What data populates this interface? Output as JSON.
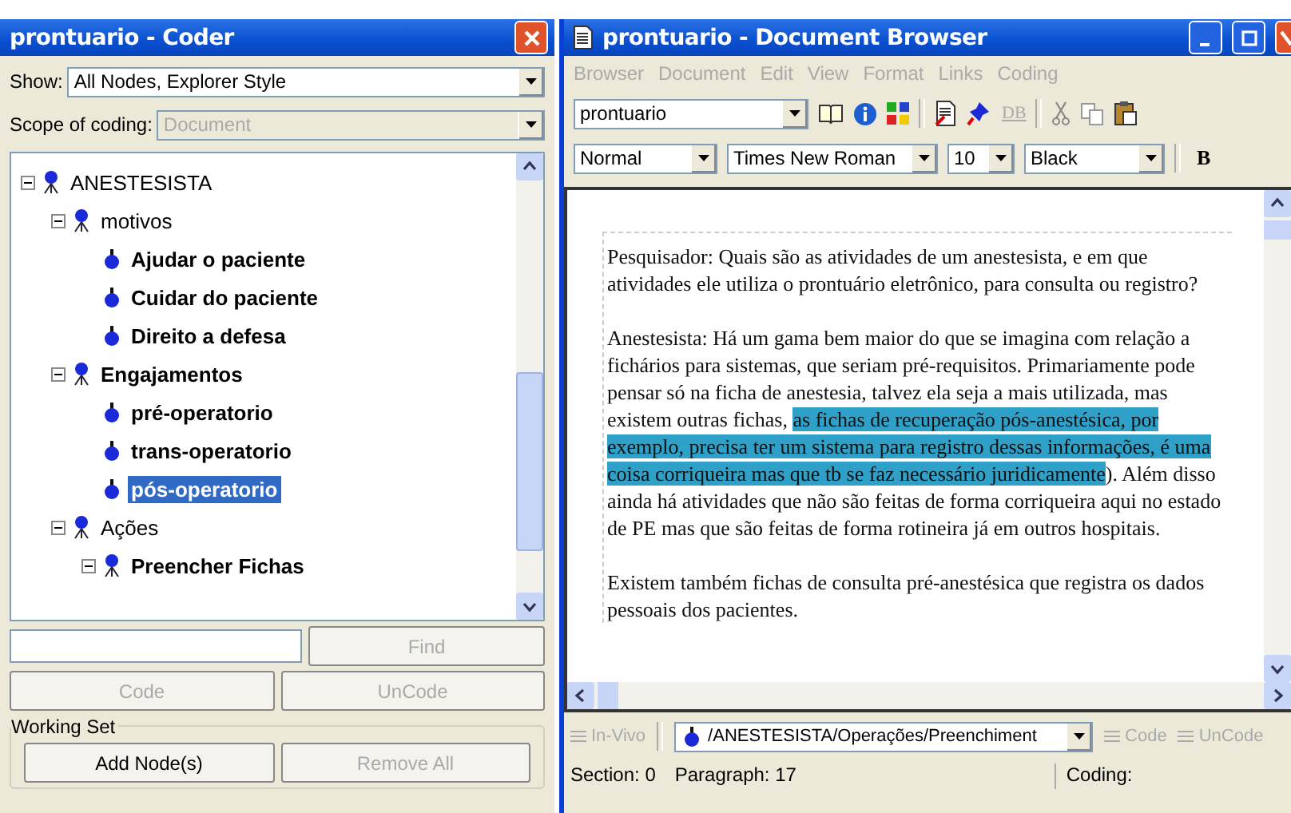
{
  "coder": {
    "title": "prontuario - Coder",
    "show": {
      "label": "Show:",
      "value": "All Nodes, Explorer Style"
    },
    "scope": {
      "label": "Scope of coding:",
      "value": "Document",
      "disabled": true
    },
    "tree": [
      {
        "label": "ANESTESISTA",
        "bold": false,
        "expanded": true,
        "selected": false,
        "children": [
          {
            "label": "motivos",
            "bold": false,
            "expanded": true,
            "selected": false,
            "children": [
              {
                "label": "Ajudar o paciente",
                "bold": true,
                "expanded": false,
                "selected": false
              },
              {
                "label": "Cuidar do paciente",
                "bold": true,
                "expanded": false,
                "selected": false
              },
              {
                "label": "Direito a defesa",
                "bold": true,
                "expanded": false,
                "selected": false
              }
            ]
          },
          {
            "label": "Engajamentos",
            "bold": true,
            "expanded": true,
            "selected": false,
            "children": [
              {
                "label": "pré-operatorio",
                "bold": true,
                "expanded": false,
                "selected": false
              },
              {
                "label": "trans-operatorio",
                "bold": true,
                "expanded": false,
                "selected": false
              },
              {
                "label": "pós-operatorio",
                "bold": true,
                "expanded": false,
                "selected": true
              }
            ]
          },
          {
            "label": "Ações",
            "bold": false,
            "expanded": true,
            "selected": false,
            "children": [
              {
                "label": "Preencher Fichas",
                "bold": true,
                "expanded": true,
                "selected": false
              }
            ]
          }
        ]
      }
    ],
    "buttons": [
      {
        "label": "Find",
        "disabled": true
      },
      {
        "label": "Code",
        "disabled": true
      },
      {
        "label": "UnCode",
        "disabled": true
      }
    ],
    "working_set": {
      "title": "Working Set",
      "buttons": [
        {
          "label": "Add Node(s)",
          "disabled": false
        },
        {
          "label": "Remove All",
          "disabled": true
        }
      ]
    }
  },
  "browser": {
    "title": "prontuario - Document Browser",
    "menu": [
      {
        "label": "Browser",
        "disabled": true
      },
      {
        "label": "Document",
        "disabled": true
      },
      {
        "label": "Edit",
        "disabled": true
      },
      {
        "label": "View",
        "disabled": true
      },
      {
        "label": "Format",
        "disabled": true
      },
      {
        "label": "Links",
        "disabled": true
      },
      {
        "label": "Coding",
        "disabled": true
      }
    ],
    "document_select": "prontuario",
    "db_button": "DB",
    "style": "Normal",
    "font": "Times New Roman",
    "size": "10",
    "text_color": "Black",
    "bold_button": "B",
    "paragraphs": [
      [
        {
          "text": "Pesquisador: Quais são as atividades de um anestesista, e em que atividades ele utiliza o prontuário eletrônico, para consulta ou registro?",
          "highlighted": false
        }
      ],
      [
        {
          "text": "Anestesista: Há um gama bem maior do que se imagina com relação a fichários para sistemas, que seriam pré-requisitos. Primariamente pode pensar só na ficha de anestesia, talvez ela seja a mais utilizada, mas existem outras fichas, ",
          "highlighted": false
        },
        {
          "text": "as fichas de recuperação pós-anestésica, por exemplo, precisa ter um sistema para registro dessas informações, é uma coisa corriqueira mas que tb se faz necessário juridicamente",
          "highlighted": true
        },
        {
          "text": "). Além disso ainda há atividades que não são feitas de forma corriqueira aqui no estado de PE mas que são feitas de forma rotineira já em outros hospitais.",
          "highlighted": false
        }
      ],
      [
        {
          "text": "Existem também fichas de consulta pré-anestésica que registra os dados pessoais dos pacientes.",
          "highlighted": false
        }
      ]
    ],
    "coding_bar": {
      "in_vivo": {
        "label": "In-Vivo",
        "disabled": true
      },
      "node": "/ANESTESISTA/Operações/Preenchiment",
      "code": {
        "label": "Code",
        "disabled": true
      },
      "uncode": {
        "label": "UnCode",
        "disabled": true
      }
    },
    "status": {
      "section": "Section: 0",
      "paragraph": "Paragraph: 17",
      "coding": "Coding:"
    }
  }
}
